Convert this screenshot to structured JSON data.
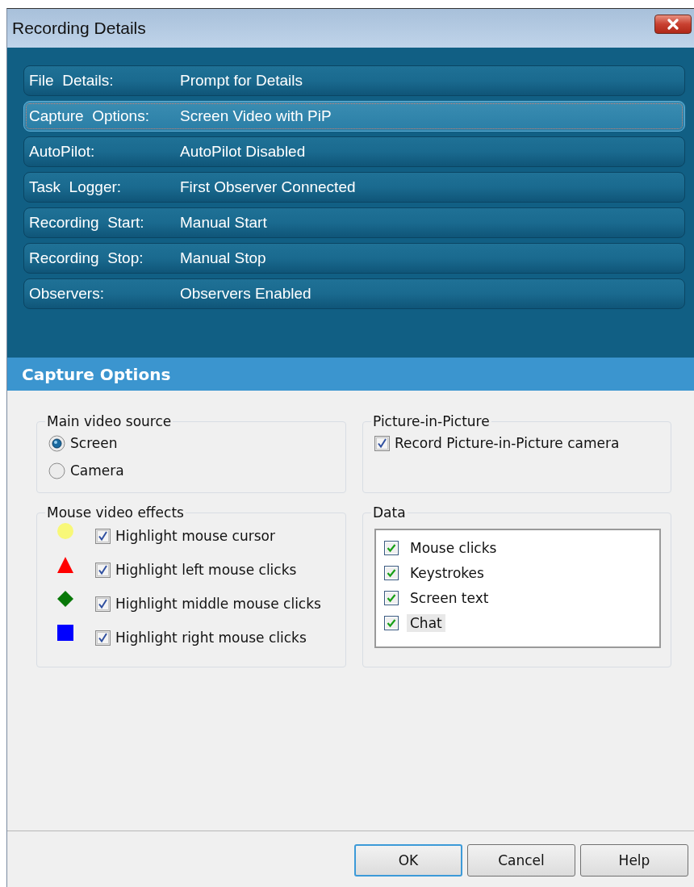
{
  "window": {
    "title": "Recording Details"
  },
  "summary_rows": [
    {
      "label": "File  Details:",
      "value": "Prompt for Details",
      "selected": false
    },
    {
      "label": "Capture  Options:",
      "value": "Screen Video with PiP",
      "selected": true
    },
    {
      "label": "AutoPilot:",
      "value": "AutoPilot Disabled",
      "selected": false
    },
    {
      "label": "Task  Logger:",
      "value": "First Observer Connected",
      "selected": false
    },
    {
      "label": "Recording  Start:",
      "value": "Manual Start",
      "selected": false
    },
    {
      "label": "Recording  Stop:",
      "value": "Manual Stop",
      "selected": false
    },
    {
      "label": "Observers:",
      "value": "Observers Enabled",
      "selected": false
    }
  ],
  "section_title": "Capture Options",
  "main_video_source": {
    "title": "Main video source",
    "options": [
      {
        "label": "Screen",
        "selected": true
      },
      {
        "label": "Camera",
        "selected": false
      }
    ]
  },
  "picture_in_picture": {
    "title": "Picture-in-Picture",
    "checkbox": {
      "label": "Record Picture-in-Picture camera",
      "checked": true
    }
  },
  "mouse_video_effects": {
    "title": "Mouse video effects",
    "items": [
      {
        "kind": "circle",
        "color": "#f8f878",
        "label": "Highlight mouse cursor",
        "checked": true
      },
      {
        "kind": "triangle",
        "color": "#ff0000",
        "label": "Highlight left mouse clicks",
        "checked": true
      },
      {
        "kind": "diamond",
        "color": "#087808",
        "label": "Highlight middle mouse clicks",
        "checked": true
      },
      {
        "kind": "square",
        "color": "#0000ff",
        "label": "Highlight right mouse clicks",
        "checked": true
      }
    ]
  },
  "data": {
    "title": "Data",
    "items": [
      {
        "label": "Mouse clicks",
        "checked": true,
        "selected": false
      },
      {
        "label": "Keystrokes",
        "checked": true,
        "selected": false
      },
      {
        "label": "Screen text",
        "checked": true,
        "selected": false
      },
      {
        "label": "Chat",
        "checked": true,
        "selected": true
      }
    ]
  },
  "buttons": [
    {
      "label": "OK",
      "default": true
    },
    {
      "label": "Cancel",
      "default": false
    },
    {
      "label": "Help",
      "default": false
    }
  ]
}
